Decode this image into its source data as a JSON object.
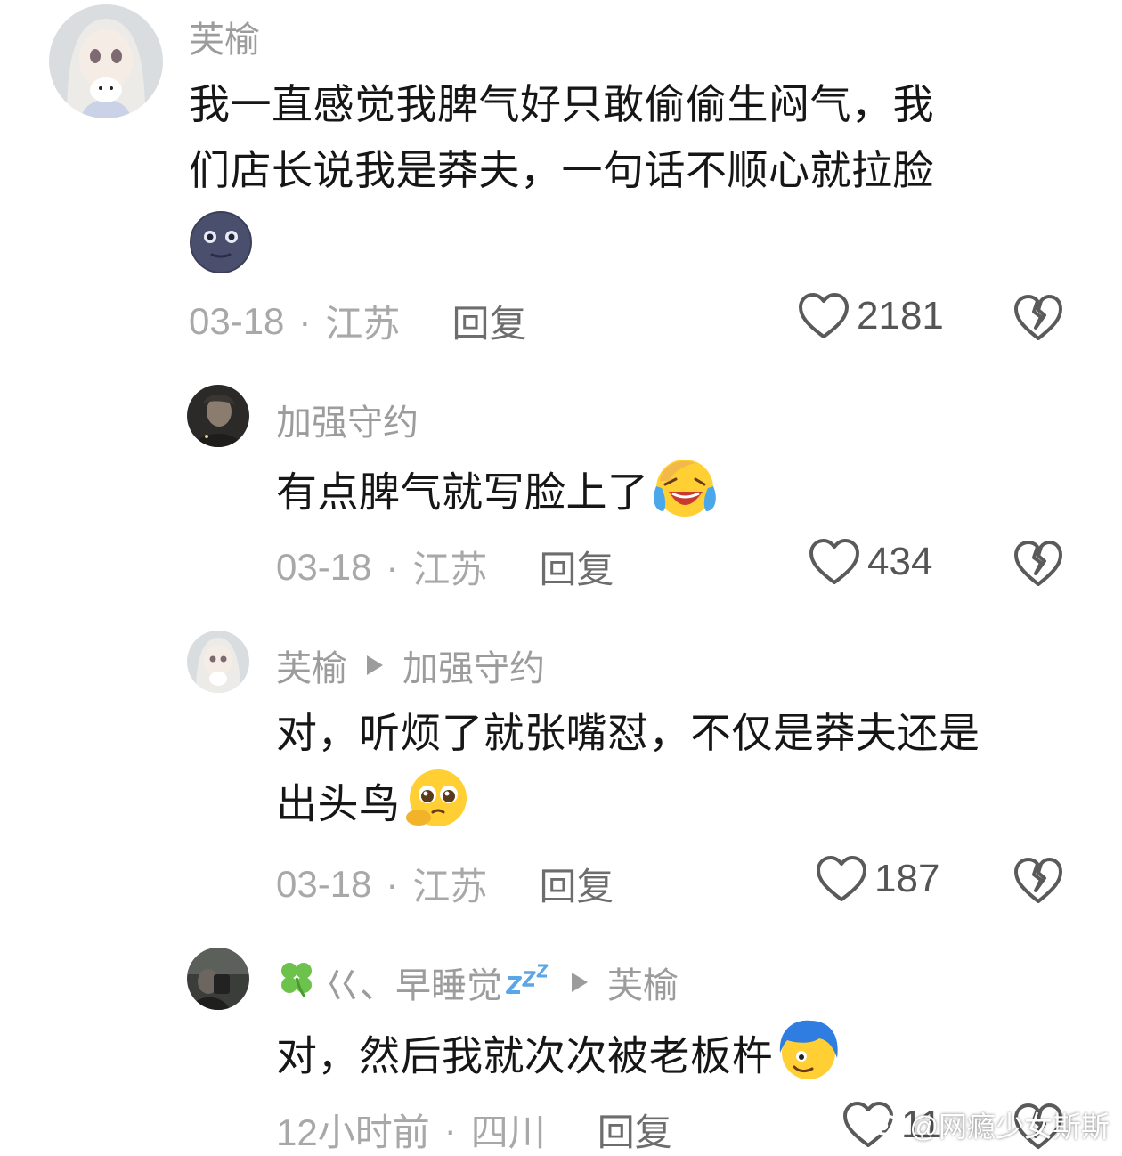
{
  "comments": [
    {
      "author": "芙榆",
      "text_line1": "我一直感觉我脾气好只敢偷偷生闷气，我",
      "text_line2": "们店长说我是莽夫，一句话不顺心就拉脸",
      "date": "03-18",
      "location": "江苏",
      "reply_label": "回复",
      "likes": "2181",
      "emoji": "new-moon-face"
    },
    {
      "author": "加强守约",
      "text": "有点脾气就写脸上了",
      "date": "03-18",
      "location": "江苏",
      "reply_label": "回复",
      "likes": "434",
      "emoji": "crying-laughing-face"
    },
    {
      "author": "芙榆",
      "reply_to": "加强守约",
      "text_line1": "对，听烦了就张嘴怼，不仅是莽夫还是",
      "text_line2": "出头鸟",
      "date": "03-18",
      "location": "江苏",
      "reply_label": "回复",
      "likes": "187",
      "emoji": "pleading-face"
    },
    {
      "author": "巜、早睡觉",
      "reply_to": "芙榆",
      "text": "对，然后我就次次被老板杵",
      "date": "12小时前",
      "location": "四川",
      "reply_label": "回复",
      "likes": "11",
      "emoji": "blue-hair-face"
    }
  ],
  "separator": "·",
  "watermark": "@网瘾少女斯斯",
  "colors": {
    "text": "#161616",
    "meta": "#a8a8a8",
    "name": "#9c9c9c"
  }
}
